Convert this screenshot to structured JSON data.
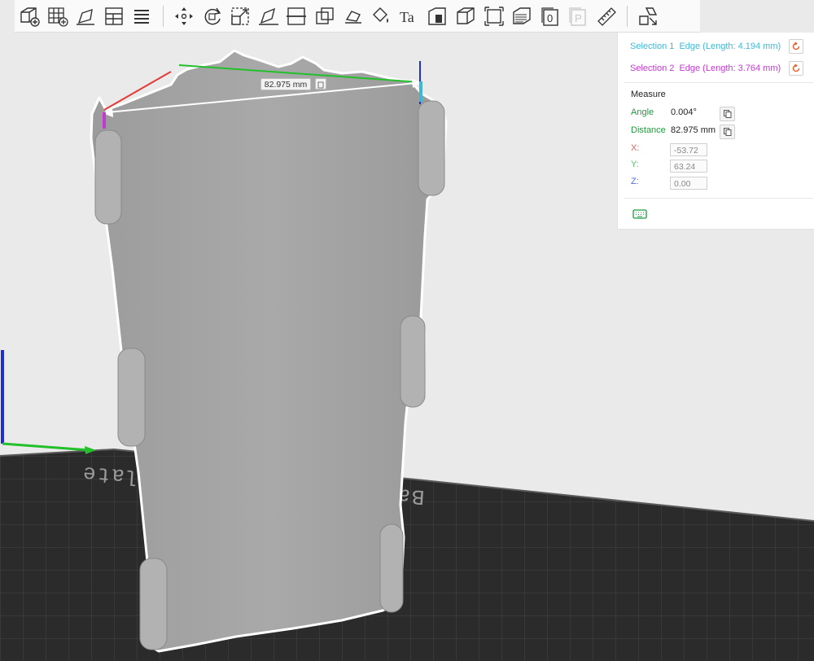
{
  "toolbar": {
    "tools": [
      {
        "icon": "add-object-icon"
      },
      {
        "icon": "arrange-grid-icon"
      },
      {
        "icon": "auto-orient-icon"
      },
      {
        "icon": "layout-icon"
      },
      {
        "icon": "layers-menu-icon"
      },
      {
        "icon": "move-icon"
      },
      {
        "icon": "rotate-icon"
      },
      {
        "icon": "scale-icon"
      },
      {
        "icon": "lay-on-face-icon"
      },
      {
        "icon": "cut-icon"
      },
      {
        "icon": "boolean-icon"
      },
      {
        "icon": "support-paint-icon"
      },
      {
        "icon": "color-paint-icon"
      },
      {
        "icon": "text-icon"
      },
      {
        "icon": "emboss-icon"
      },
      {
        "icon": "assembly-icon"
      },
      {
        "icon": "fit-view-icon"
      },
      {
        "icon": "variable-layer-icon"
      },
      {
        "icon": "zero-icon"
      },
      {
        "icon": "p-icon"
      },
      {
        "icon": "measure-icon"
      },
      {
        "icon": "assemble-view-icon"
      }
    ],
    "text_tool_label": "Ta",
    "zero_label": "0",
    "p_label": "P"
  },
  "measure_panel": {
    "selection1_label": "Selection 1",
    "selection1_value": "Edge (Length: 4.194 mm)",
    "selection2_label": "Selection 2",
    "selection2_value": "Edge (Length: 3.764 mm)",
    "section_title": "Measure",
    "angle_label": "Angle",
    "angle_value": "0.004°",
    "distance_label": "Distance",
    "distance_value": "82.975 mm",
    "x_label": "X:",
    "x_value": "-53.72",
    "y_label": "Y:",
    "y_value": "63.24",
    "z_label": "Z:",
    "z_value": "0.00",
    "reset_icon": "reset-icon",
    "copy_icon": "copy-icon",
    "keyboard_icon": "keyboard-icon"
  },
  "viewport": {
    "dimension_label": "82.975 mm",
    "plate_text": "Bambu Textured PEI Plate",
    "colors": {
      "background": "#eaeaea",
      "plate": "#2b2b2b",
      "model": "#a6a6a6",
      "outline": "#ffffff",
      "x_axis": "#e53935",
      "y_axis": "#22c02a",
      "z_axis": "#1e30c8"
    }
  }
}
